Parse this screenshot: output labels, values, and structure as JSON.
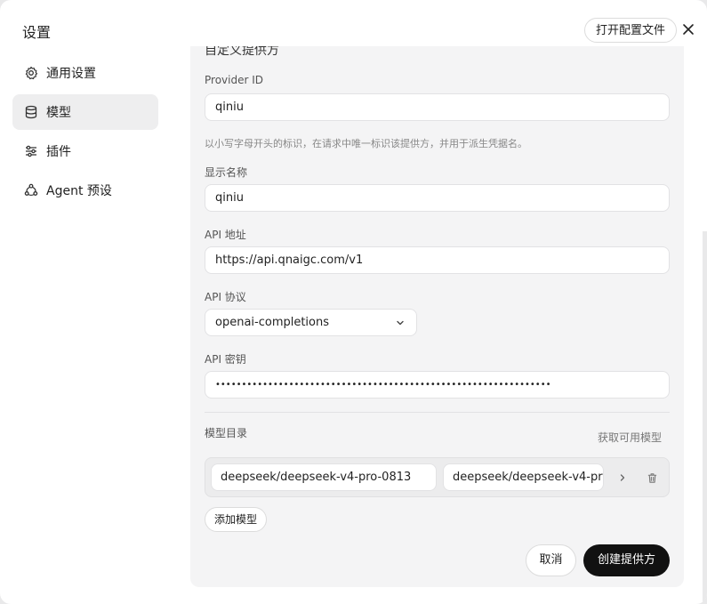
{
  "window": {
    "title": "设置",
    "open_config_label": "打开配置文件"
  },
  "sidebar": {
    "items": [
      {
        "label": "通用设置",
        "icon": "gear-icon"
      },
      {
        "label": "模型",
        "icon": "database-icon",
        "active": true
      },
      {
        "label": "插件",
        "icon": "sliders-icon"
      },
      {
        "label": "Agent 预设",
        "icon": "agent-icon"
      }
    ]
  },
  "form": {
    "section_title": "自定义提供方",
    "provider_id": {
      "label": "Provider ID",
      "value": "qiniu",
      "hint": "以小写字母开头的标识，在请求中唯一标识该提供方，并用于派生凭据名。"
    },
    "display_name": {
      "label": "显示名称",
      "value": "qiniu"
    },
    "api_url": {
      "label": "API 地址",
      "value": "https://api.qnaigc.com/v1"
    },
    "api_protocol": {
      "label": "API 协议",
      "value": "openai-completions"
    },
    "api_key": {
      "label": "API 密钥",
      "value": "••••••••••••••••••••••••••••••••••••••••••••••••••••••••••••••••"
    },
    "catalog": {
      "label": "模型目录",
      "fetch_label": "获取可用模型",
      "models": [
        {
          "id": "deepseek/deepseek-v4-pro-0813",
          "name": "deepseek/deepseek-v4-pr"
        }
      ],
      "add_label": "添加模型"
    }
  },
  "actions": {
    "cancel_label": "取消",
    "create_label": "创建提供方"
  }
}
